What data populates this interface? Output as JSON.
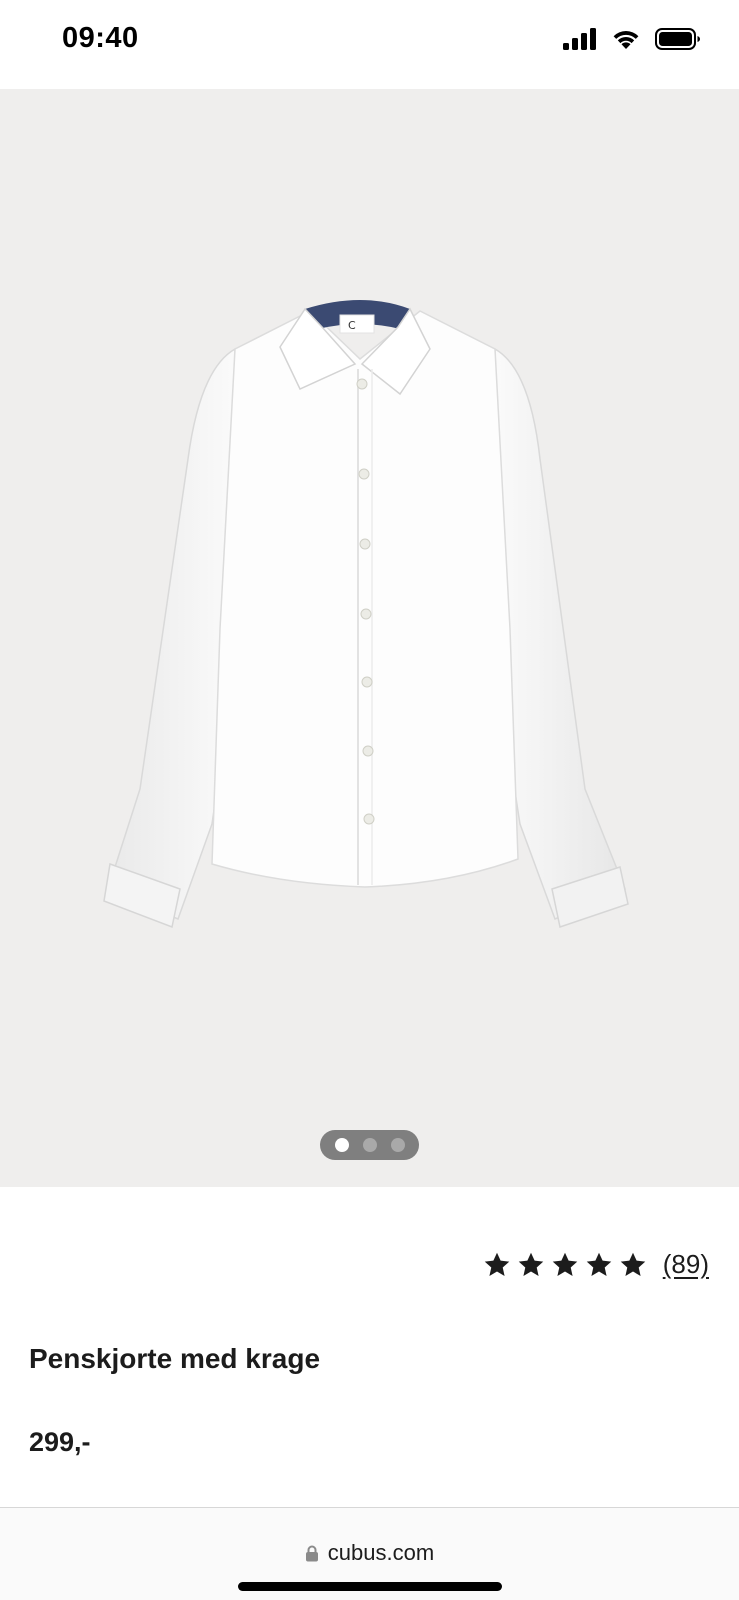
{
  "status_bar": {
    "time": "09:40",
    "icons": [
      "cellular-signal-icon",
      "wifi-icon",
      "battery-icon"
    ]
  },
  "gallery": {
    "image_alt": "Penskjorte med krage",
    "slides": 3,
    "active_slide": 1
  },
  "product": {
    "rating_stars": 5,
    "rating_count": "(89)",
    "title": "Penskjorte med krage",
    "price": "299,-"
  },
  "browser": {
    "url": "cubus.com",
    "lock_icon": "lock-icon"
  },
  "colors": {
    "gallery_bg": "#efeeed",
    "text": "#1c1c1c",
    "collar_inner": "#3b4a72"
  }
}
